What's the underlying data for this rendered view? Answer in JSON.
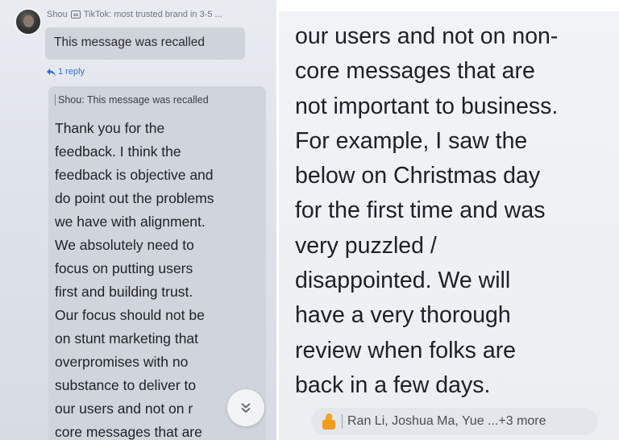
{
  "left": {
    "header": {
      "sender": "Shou",
      "group": "TikTok: most trusted brand in 3-5 ..."
    },
    "recalled_message": "This message was recalled",
    "reply_link": "1 reply",
    "quote": "Shou: This message was recalled",
    "body_lines": [
      "Thank you for the",
      "feedback. I think the",
      "feedback is objective and",
      "do point out the problems",
      "we have with alignment.",
      "We absolutely need to",
      "focus on putting users",
      "first and building trust.",
      "Our focus should not be",
      "on stunt marketing that",
      "overpromises with no",
      "substance to deliver to",
      "our users and not on r",
      "core messages that are"
    ],
    "scroll_icon": "double-chevron-down-icon"
  },
  "right": {
    "body_lines": [
      "our users and not on non-",
      "core messages that are",
      "not important to business.",
      "For example, I saw the",
      "below on Christmas day",
      "for the first time and was",
      "very puzzled /",
      "disappointed. We will",
      "have a very thorough",
      "review when folks are",
      "back in a few days."
    ],
    "reactions": {
      "icon": "thumbs-up-icon",
      "text": "Ran Li, Joshua Ma, Yue ...+3 more"
    }
  },
  "colors": {
    "link": "#2f6fd6",
    "reaction_icon": "#f39a1a"
  }
}
